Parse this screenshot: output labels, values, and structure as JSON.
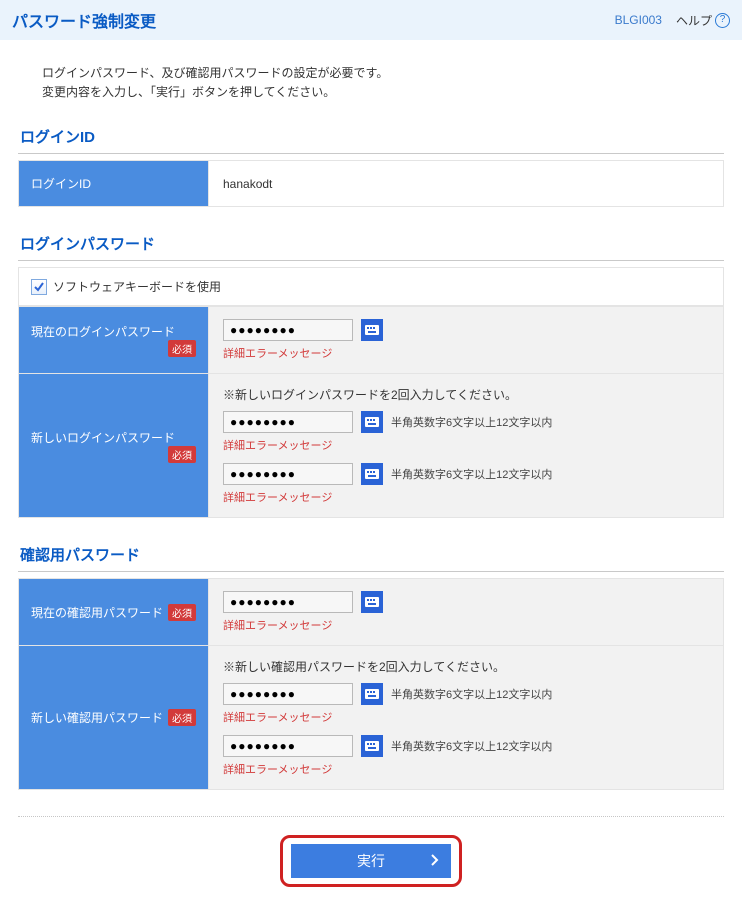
{
  "header": {
    "title": "パスワード強制変更",
    "screen_id": "BLGI003",
    "help_label": "ヘルプ"
  },
  "intro": {
    "line1": "ログインパスワード、及び確認用パスワードの設定が必要です。",
    "line2": "変更内容を入力し、「実行」ボタンを押してください。"
  },
  "sections": {
    "login_id": {
      "title": "ログインID",
      "label": "ログインID",
      "value": "hanakodt"
    },
    "login_pw": {
      "title": "ログインパスワード",
      "soft_kb_label": "ソフトウェアキーボードを使用",
      "soft_kb_checked": true,
      "current": {
        "label": "現在のログインパスワード",
        "required": "必須",
        "value": "●●●●●●●●",
        "error": "詳細エラーメッセージ"
      },
      "new": {
        "label": "新しいログインパスワード",
        "required": "必須",
        "note": "※新しいログインパスワードを2回入力してください。",
        "hint": "半角英数字6文字以上12文字以内",
        "value1": "●●●●●●●●",
        "error1": "詳細エラーメッセージ",
        "value2": "●●●●●●●●",
        "error2": "詳細エラーメッセージ"
      }
    },
    "confirm_pw": {
      "title": "確認用パスワード",
      "current": {
        "label": "現在の確認用パスワード",
        "required": "必須",
        "value": "●●●●●●●●",
        "error": "詳細エラーメッセージ"
      },
      "new": {
        "label": "新しい確認用パスワード",
        "required": "必須",
        "note": "※新しい確認用パスワードを2回入力してください。",
        "hint": "半角英数字6文字以上12文字以内",
        "value1": "●●●●●●●●",
        "error1": "詳細エラーメッセージ",
        "value2": "●●●●●●●●",
        "error2": "詳細エラーメッセージ"
      }
    }
  },
  "submit_label": "実行"
}
